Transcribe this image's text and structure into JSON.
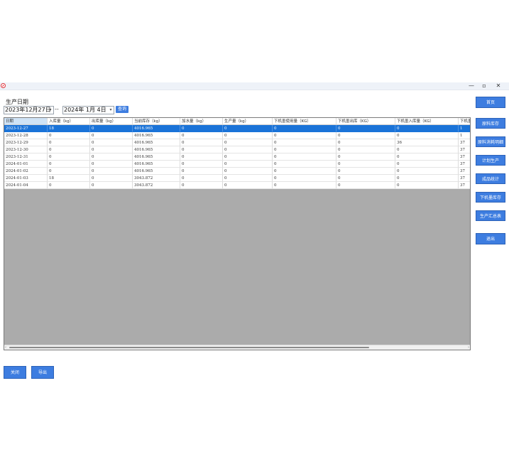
{
  "window": {
    "min_glyph": "—",
    "max_glyph": "▫",
    "close_glyph": "✕"
  },
  "filter": {
    "label": "生产日期",
    "date_from": "2023年12月27日",
    "date_to": "2024年  1月  4日",
    "separator": "--",
    "query_label": "查询"
  },
  "table": {
    "columns": [
      "日期",
      "入库量（kg）",
      "出库量（kg）",
      "当前库存（kg）",
      "加水量（kg）",
      "生产量（kg）",
      "下机墨使用量（KG）",
      "下机墨出库（KG）",
      "下机墨入库量（KG）",
      "下机墨"
    ],
    "rows": [
      [
        "2023-12-27",
        "18",
        "0",
        "4016.965",
        "0",
        "0",
        "0",
        "0",
        "0",
        "1"
      ],
      [
        "2023-12-28",
        "0",
        "0",
        "4016.965",
        "0",
        "0",
        "0",
        "0",
        "0",
        "1"
      ],
      [
        "2023-12-29",
        "0",
        "0",
        "4016.965",
        "0",
        "0",
        "0",
        "0",
        "36",
        "37"
      ],
      [
        "2023-12-30",
        "0",
        "0",
        "4016.965",
        "0",
        "0",
        "0",
        "0",
        "0",
        "37"
      ],
      [
        "2023-12-31",
        "0",
        "0",
        "4016.965",
        "0",
        "0",
        "0",
        "0",
        "0",
        "37"
      ],
      [
        "2024-01-01",
        "0",
        "0",
        "4016.965",
        "0",
        "0",
        "0",
        "0",
        "0",
        "37"
      ],
      [
        "2024-01-02",
        "0",
        "0",
        "4016.965",
        "0",
        "0",
        "0",
        "0",
        "0",
        "37"
      ],
      [
        "2024-01-03",
        "18",
        "0",
        "3043.872",
        "0",
        "0",
        "0",
        "0",
        "0",
        "37"
      ],
      [
        "2024-01-04",
        "0",
        "0",
        "3043.872",
        "0",
        "0",
        "0",
        "0",
        "0",
        "37"
      ]
    ],
    "scroll_left": "‹",
    "scroll_right": "›"
  },
  "sidebar": {
    "home": "首页",
    "raw_stock": "原料库存",
    "raw_consumption": "原料消耗明细",
    "plan_production": "计划生产",
    "product_stats": "成品统计",
    "ink_stock": "下机墨库存",
    "production_summary": "生产汇总表",
    "exit": "退出"
  },
  "footer": {
    "close_label": "关闭",
    "export_label": "导出"
  },
  "colors": {
    "accent": "#3d7de0",
    "selection": "#1a73d8",
    "grid_empty": "#ababab"
  }
}
